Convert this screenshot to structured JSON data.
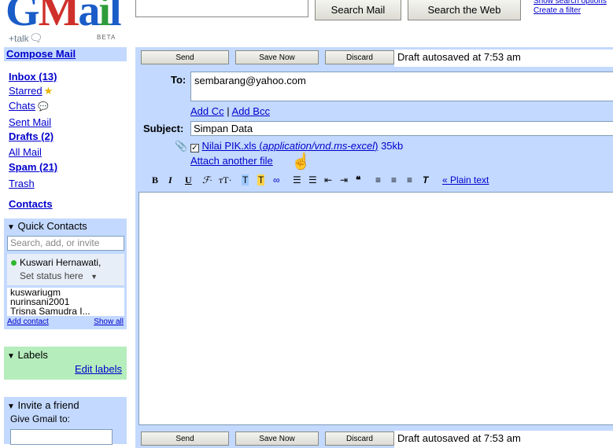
{
  "logo": {
    "text": "Gmail",
    "sub": "+talk",
    "beta": "BETA"
  },
  "header": {
    "search_mail": "Search Mail",
    "search_web": "Search the Web",
    "show_options": "Show search options",
    "create_filter": "Create a filter"
  },
  "sidebar": {
    "compose": "Compose Mail",
    "inbox": "Inbox (13)",
    "starred": "Starred",
    "chats": "Chats",
    "sent": "Sent Mail",
    "drafts": "Drafts (2)",
    "all": "All Mail",
    "spam": "Spam (21)",
    "trash": "Trash",
    "contacts": "Contacts"
  },
  "quick_contacts": {
    "title": "Quick Contacts",
    "search_placeholder": "Search, add, or invite",
    "self_name": "Kuswari Hernawati,",
    "status": "Set status here",
    "contacts": [
      "kuswariugm",
      "nurinsani2001",
      "Trisna Samudra  I..."
    ],
    "add_contact": "Add contact",
    "show_all": "Show all"
  },
  "labels": {
    "title": "Labels",
    "edit": "Edit labels"
  },
  "invite": {
    "title": "Invite a friend",
    "give": "Give Gmail to:"
  },
  "compose": {
    "send": "Send",
    "save_now": "Save Now",
    "discard": "Discard",
    "autosave": "Draft autosaved at 7:53 am",
    "to_label": "To:",
    "to_value": "sembarang@yahoo.com",
    "add_cc": "Add Cc",
    "add_bcc": "Add Bcc",
    "subject_label": "Subject:",
    "subject_value": "Simpan Data",
    "attachment_name": "Nilai PIK.xls",
    "attachment_type": "application/vnd.ms-excel",
    "attachment_size": "35kb",
    "attach_another": "Attach another file",
    "plain_text": "« Plain text"
  }
}
